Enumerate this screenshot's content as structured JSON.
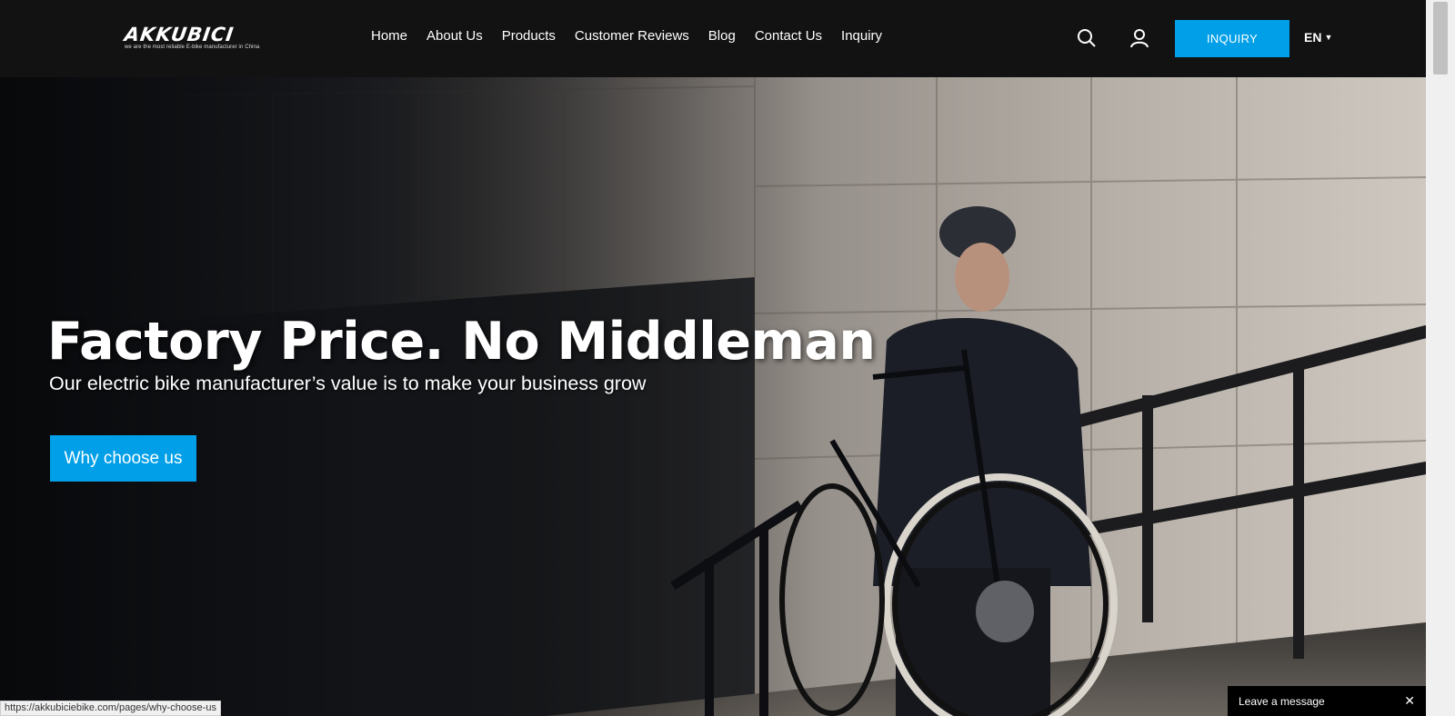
{
  "brand": {
    "name": "AKKUBICI",
    "tagline": "we are the most reliable E-bike manufacturer in China"
  },
  "nav": {
    "items": [
      {
        "label": "Home"
      },
      {
        "label": "About Us"
      },
      {
        "label": "Products"
      },
      {
        "label": "Customer Reviews"
      },
      {
        "label": "Blog"
      },
      {
        "label": "Contact Us"
      },
      {
        "label": "Inquiry"
      }
    ]
  },
  "header": {
    "search_icon": "search-icon",
    "user_icon": "user-icon",
    "inquiry_label": "INQUIRY",
    "language": "EN"
  },
  "hero": {
    "title": "Factory Price. No Middleman",
    "subtitle": "Our electric bike manufacturer’s value is to make your business grow",
    "cta_label": "Why choose us"
  },
  "status_bar": {
    "url": "https://akkubiciebike.com/pages/why-choose-us"
  },
  "chat": {
    "label": "Leave a message",
    "close": "✕"
  },
  "colors": {
    "accent": "#009fe8",
    "header_bg": "#121212"
  }
}
